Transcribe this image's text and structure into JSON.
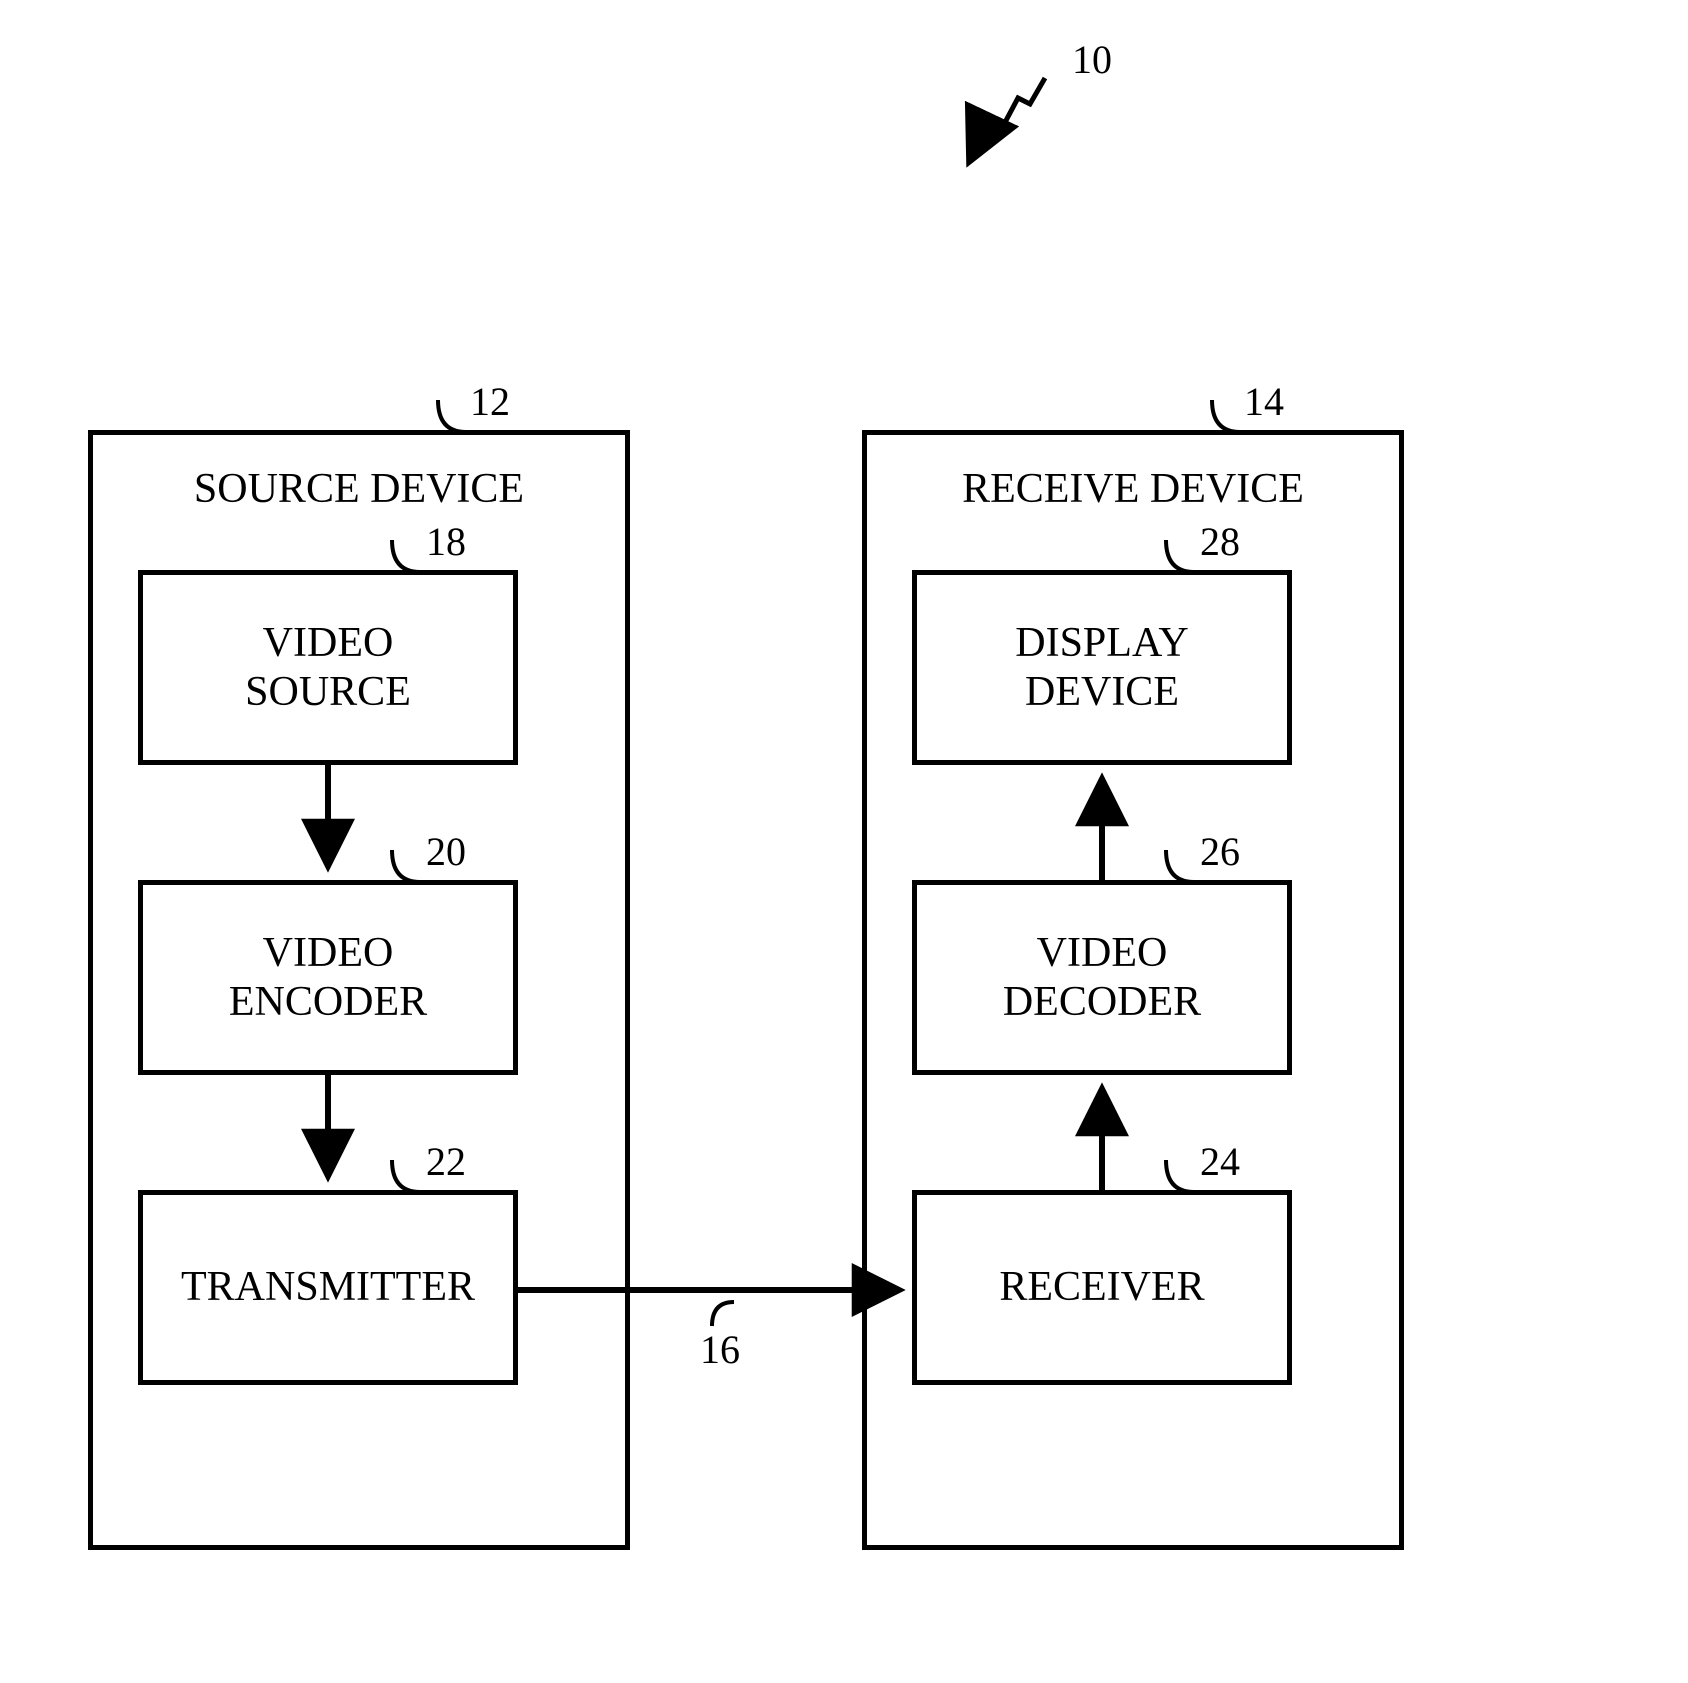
{
  "figure_ref": "10",
  "source_device": {
    "ref": "12",
    "title": "SOURCE DEVICE",
    "blocks": {
      "video_source": {
        "ref": "18",
        "label": "VIDEO\nSOURCE"
      },
      "video_encoder": {
        "ref": "20",
        "label": "VIDEO\nENCODER"
      },
      "transmitter": {
        "ref": "22",
        "label": "TRANSMITTER"
      }
    }
  },
  "receive_device": {
    "ref": "14",
    "title": "RECEIVE DEVICE",
    "blocks": {
      "display_device": {
        "ref": "28",
        "label": "DISPLAY\nDEVICE"
      },
      "video_decoder": {
        "ref": "26",
        "label": "VIDEO\nDECODER"
      },
      "receiver": {
        "ref": "24",
        "label": "RECEIVER"
      }
    }
  },
  "link_ref": "16"
}
